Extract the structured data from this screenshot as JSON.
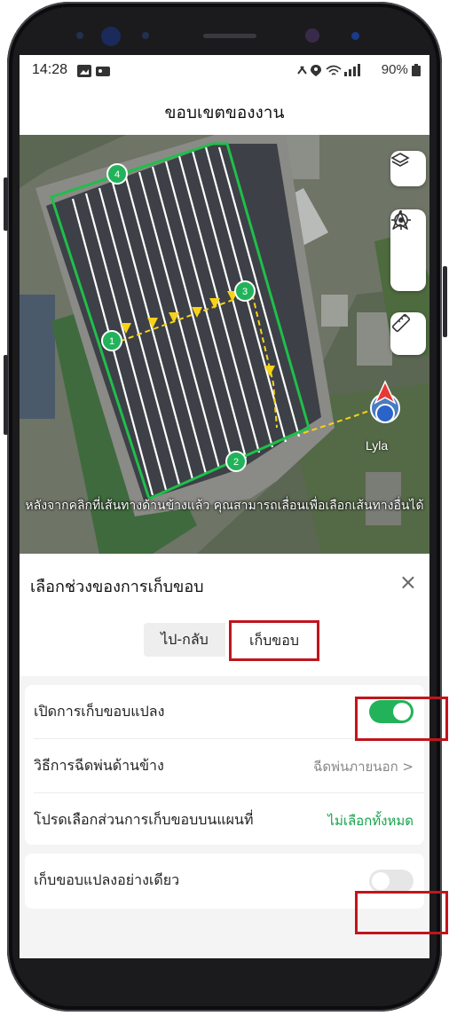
{
  "status": {
    "time": "14:28",
    "battery": "90%"
  },
  "page": {
    "title": "ขอบเขตของงาน"
  },
  "map": {
    "waypoints": [
      "1",
      "2",
      "3",
      "4"
    ],
    "user_name": "Lyla",
    "hint": "หลังจากคลิกที่เส้นทางด้านข้างแล้ว คุณสามารถเลื่อนเพื่อเลือกเส้นทางอื่นได้",
    "buttons": [
      "layers-icon",
      "navigation-arrow-icon",
      "locate-icon",
      "ruler-icon"
    ]
  },
  "sheet": {
    "title": "เลือกช่วงของการเก็บขอบ",
    "close": "×",
    "tabs": [
      {
        "label": "ไป-กลับ",
        "selected": false
      },
      {
        "label": "เก็บขอบ",
        "selected": true
      }
    ],
    "settings": {
      "enable_edge": {
        "label": "เปิดการเก็บขอบแปลง",
        "on": true
      },
      "spray_method": {
        "label": "วิธีการฉีดพ่นด้านข้าง",
        "value": "ฉีดพ่นภายนอก >"
      },
      "select_part": {
        "label": "โปรดเลือกส่วนการเก็บขอบบนแผนที่",
        "action": "ไม่เลือกทั้งหมด"
      },
      "edge_only": {
        "label": "เก็บขอบแปลงอย่างเดียว",
        "on": false
      }
    }
  },
  "colors": {
    "accent_green": "#22b35a",
    "highlight_red": "#c0151c",
    "toggle_off": "#e6e6e6"
  }
}
